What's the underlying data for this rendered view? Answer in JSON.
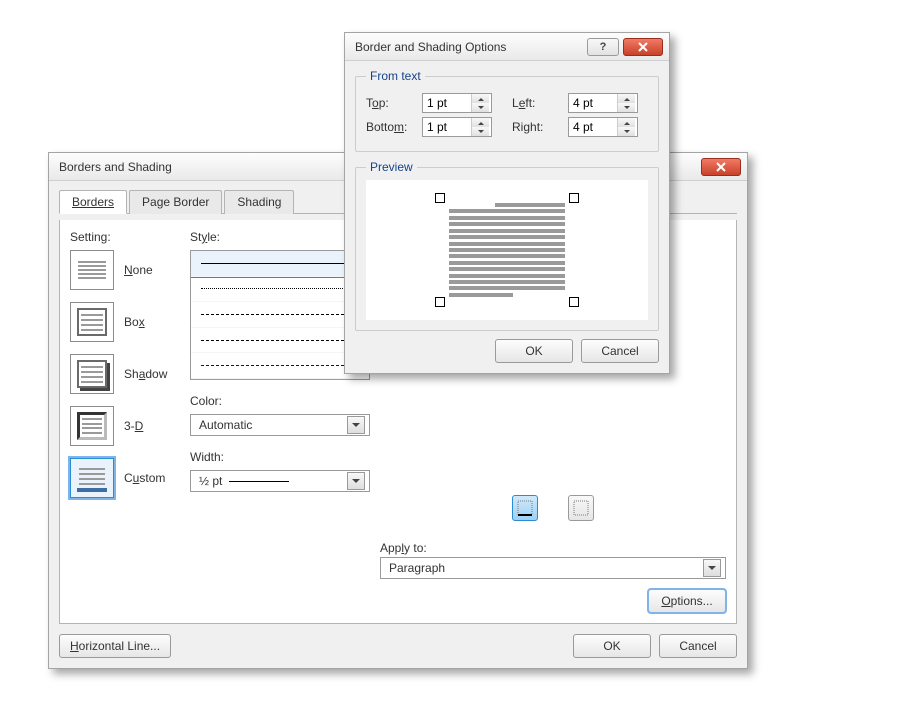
{
  "main_dialog": {
    "title": "Borders and Shading",
    "tabs": {
      "borders": "Borders",
      "page_border": "Page Border",
      "shading": "Shading"
    },
    "setting_head": "Setting:",
    "settings": {
      "none": "None",
      "box": "Box",
      "shadow": "Shadow",
      "three_d": "3-D",
      "custom": "Custom"
    },
    "style_head": "Style:",
    "color_head": "Color:",
    "color_value": "Automatic",
    "width_head": "Width:",
    "width_value": "½ pt",
    "apply_to_label": "Apply to:",
    "apply_to_value": "Paragraph",
    "options_btn": "Options...",
    "horizontal_line_btn": "Horizontal Line...",
    "ok": "OK",
    "cancel": "Cancel"
  },
  "options_dialog": {
    "title": "Border and Shading Options",
    "from_text_legend": "From text",
    "labels": {
      "top": "Top:",
      "bottom": "Bottom:",
      "left": "Left:",
      "right": "Right:"
    },
    "values": {
      "top": "1 pt",
      "bottom": "1 pt",
      "left": "4 pt",
      "right": "4 pt"
    },
    "preview_legend": "Preview",
    "ok": "OK",
    "cancel": "Cancel"
  }
}
